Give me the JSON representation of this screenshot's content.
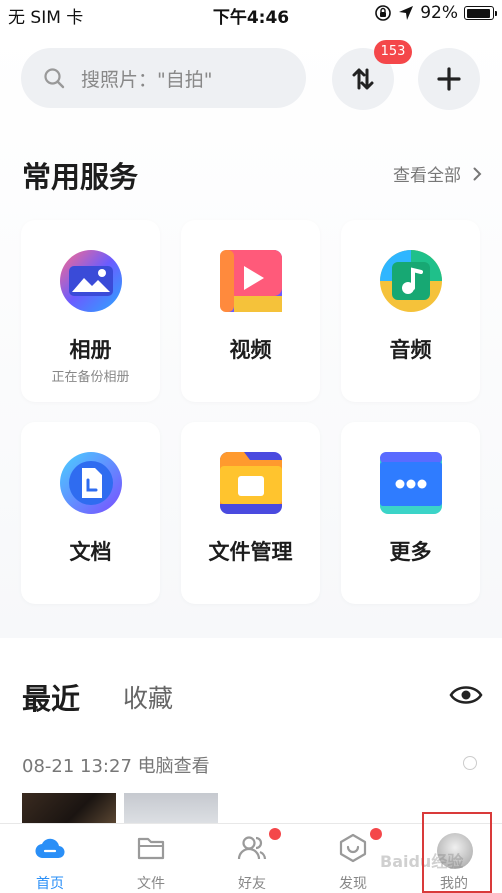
{
  "status_bar": {
    "carrier": "无 SIM 卡",
    "time": "下午4:46",
    "battery": "92%",
    "battery_level": 0.92
  },
  "header": {
    "search_placeholder": "搜照片：\"自拍\"",
    "transfer_badge": "153"
  },
  "services": {
    "title": "常用服务",
    "view_all": "查看全部",
    "items": [
      {
        "label": "相册",
        "sub": "正在备份相册",
        "icon": "photo-album-icon"
      },
      {
        "label": "视频",
        "sub": "",
        "icon": "video-icon"
      },
      {
        "label": "音频",
        "sub": "",
        "icon": "audio-icon"
      },
      {
        "label": "文档",
        "sub": "",
        "icon": "document-icon"
      },
      {
        "label": "文件管理",
        "sub": "",
        "icon": "file-manager-icon"
      },
      {
        "label": "更多",
        "sub": "",
        "icon": "more-icon"
      }
    ]
  },
  "recent": {
    "tab_recent": "最近",
    "tab_favorites": "收藏",
    "entry_header": "08-21 13:27 电脑查看"
  },
  "nav": {
    "items": [
      {
        "label": "首页",
        "active": true
      },
      {
        "label": "文件",
        "active": false
      },
      {
        "label": "好友",
        "active": false,
        "dot": true
      },
      {
        "label": "发现",
        "active": false,
        "dot": true
      },
      {
        "label": "我的",
        "active": false
      }
    ]
  },
  "watermark": "Baidu经验",
  "colors": {
    "accent": "#2a8ff7",
    "badge": "#f4474a",
    "highlight_box": "#d93a3a"
  }
}
